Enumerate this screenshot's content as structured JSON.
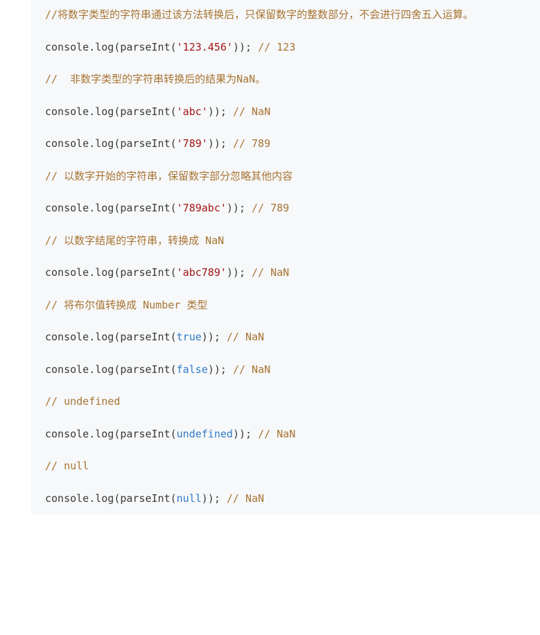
{
  "code": {
    "lines": [
      {
        "type": "comment",
        "text": "//将数字类型的字符串通过该方法转换后，只保留数字的整数部分，不会进行四舍五入运算。"
      },
      {
        "type": "blank"
      },
      {
        "type": "stmt",
        "prefix": "console.log(parseInt(",
        "arg": "'123.456'",
        "argKind": "string",
        "suffix": ")); ",
        "trail": "// 123"
      },
      {
        "type": "blank"
      },
      {
        "type": "comment",
        "text": "//  非数字类型的字符串转换后的结果为NaN。"
      },
      {
        "type": "blank"
      },
      {
        "type": "stmt",
        "prefix": "console.log(parseInt(",
        "arg": "'abc'",
        "argKind": "string",
        "suffix": ")); ",
        "trail": "// NaN"
      },
      {
        "type": "blank"
      },
      {
        "type": "stmt",
        "prefix": "console.log(parseInt(",
        "arg": "'789'",
        "argKind": "string",
        "suffix": ")); ",
        "trail": "// 789"
      },
      {
        "type": "blank"
      },
      {
        "type": "comment",
        "text": "// 以数字开始的字符串，保留数字部分忽略其他内容"
      },
      {
        "type": "blank"
      },
      {
        "type": "stmt",
        "prefix": "console.log(parseInt(",
        "arg": "'789abc'",
        "argKind": "string",
        "suffix": ")); ",
        "trail": "// 789"
      },
      {
        "type": "blank"
      },
      {
        "type": "comment",
        "text": "// 以数字结尾的字符串，转换成 NaN"
      },
      {
        "type": "blank"
      },
      {
        "type": "stmt",
        "prefix": "console.log(parseInt(",
        "arg": "'abc789'",
        "argKind": "string",
        "suffix": ")); ",
        "trail": "// NaN"
      },
      {
        "type": "blank"
      },
      {
        "type": "comment",
        "text": "// 将布尔值转换成 Number 类型"
      },
      {
        "type": "blank"
      },
      {
        "type": "stmt",
        "prefix": "console.log(parseInt(",
        "arg": "true",
        "argKind": "keyword",
        "suffix": ")); ",
        "trail": "// NaN"
      },
      {
        "type": "blank"
      },
      {
        "type": "stmt",
        "prefix": "console.log(parseInt(",
        "arg": "false",
        "argKind": "keyword",
        "suffix": ")); ",
        "trail": "// NaN"
      },
      {
        "type": "blank"
      },
      {
        "type": "comment",
        "text": "// undefined"
      },
      {
        "type": "blank"
      },
      {
        "type": "stmt",
        "prefix": "console.log(parseInt(",
        "arg": "undefined",
        "argKind": "keyword",
        "suffix": ")); ",
        "trail": "// NaN"
      },
      {
        "type": "blank"
      },
      {
        "type": "comment",
        "text": "// null"
      },
      {
        "type": "blank"
      },
      {
        "type": "stmt",
        "prefix": "console.log(parseInt(",
        "arg": "null",
        "argKind": "keyword",
        "suffix": ")); ",
        "trail": "// NaN"
      }
    ]
  }
}
